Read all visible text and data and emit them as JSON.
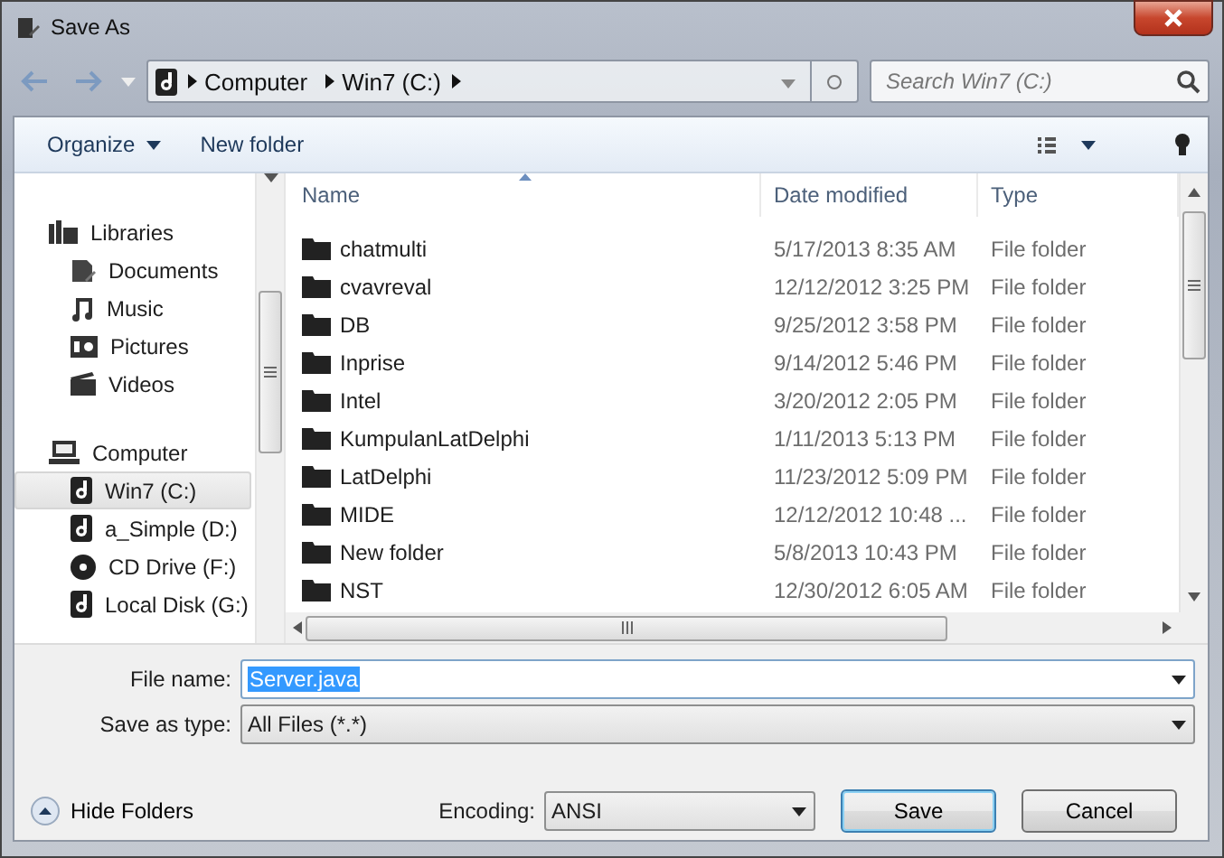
{
  "window": {
    "title": "Save As"
  },
  "address": {
    "crumbs": [
      "Computer",
      "Win7 (C:)"
    ]
  },
  "search": {
    "placeholder": "Search Win7 (C:)"
  },
  "toolbar": {
    "buttons": [
      "Organize",
      "New folder"
    ]
  },
  "sidebar": {
    "items": [
      {
        "label": "Libraries",
        "kind": "libraries",
        "selected": false,
        "children": [
          {
            "label": "Documents",
            "kind": "documents",
            "selected": false
          },
          {
            "label": "Music",
            "kind": "music",
            "selected": false
          },
          {
            "label": "Pictures",
            "kind": "pictures",
            "selected": false
          },
          {
            "label": "Videos",
            "kind": "videos",
            "selected": false
          }
        ]
      },
      {
        "label": "Computer",
        "kind": "computer",
        "selected": false,
        "children": [
          {
            "label": "Win7 (C:)",
            "kind": "drive",
            "selected": true
          },
          {
            "label": "a_Simple (D:)",
            "kind": "drive",
            "selected": false
          },
          {
            "label": "CD Drive (F:)",
            "kind": "cd",
            "selected": false
          },
          {
            "label": "Local Disk (G:)",
            "kind": "drive",
            "selected": false
          }
        ]
      }
    ]
  },
  "table": {
    "columns": [
      "Name",
      "Date modified",
      "Type"
    ],
    "rows": [
      {
        "name": "chatmulti",
        "date": "5/17/2013 8:35 AM",
        "type": "File folder"
      },
      {
        "name": "cvavreval",
        "date": "12/12/2012 3:25 PM",
        "type": "File folder"
      },
      {
        "name": "DB",
        "date": "9/25/2012 3:58 PM",
        "type": "File folder"
      },
      {
        "name": "Inprise",
        "date": "9/14/2012 5:46 PM",
        "type": "File folder"
      },
      {
        "name": "Intel",
        "date": "3/20/2012 2:05 PM",
        "type": "File folder"
      },
      {
        "name": "KumpulanLatDelphi",
        "date": "1/11/2013 5:13 PM",
        "type": "File folder"
      },
      {
        "name": "LatDelphi",
        "date": "11/23/2012 5:09 PM",
        "type": "File folder"
      },
      {
        "name": "MIDE",
        "date": "12/12/2012 10:48 ...",
        "type": "File folder"
      },
      {
        "name": "New folder",
        "date": "5/8/2013 10:43 PM",
        "type": "File folder"
      },
      {
        "name": "NST",
        "date": "12/30/2012 6:05 AM",
        "type": "File folder"
      }
    ]
  },
  "file_name": {
    "label": "File name:",
    "value": "Server.java"
  },
  "save_as_type": {
    "label": "Save as type:",
    "value": "All Files  (*.*)"
  },
  "hide_folders": "Hide Folders",
  "encoding": {
    "label": "Encoding:",
    "value": "ANSI"
  },
  "buttons": [
    "Save",
    "Cancel"
  ]
}
